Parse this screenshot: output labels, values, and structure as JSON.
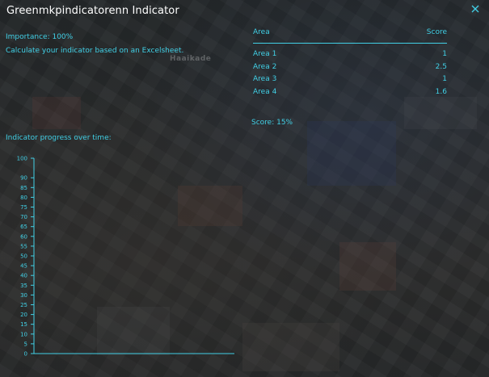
{
  "window": {
    "title": "Greenmkpindicatorenn Indicator"
  },
  "info": {
    "importance": "Importance: 100%",
    "description": "Calculate your indicator based on an Excelsheet."
  },
  "map_label": "Haaikade",
  "table": {
    "headers": {
      "area": "Area",
      "score": "Score"
    },
    "rows": [
      {
        "area": "Area 1",
        "score": "1"
      },
      {
        "area": "Area 2",
        "score": "2.5"
      },
      {
        "area": "Area 3",
        "score": "1"
      },
      {
        "area": "Area 4",
        "score": "1.6"
      }
    ]
  },
  "score_text": "Score: 15%",
  "chart_data": {
    "type": "line",
    "title": "Indicator progress over time:",
    "ylim": [
      0,
      100
    ],
    "yticks": [
      "0",
      "5",
      "10",
      "15",
      "20",
      "25",
      "30",
      "35",
      "40",
      "45",
      "50",
      "55",
      "60",
      "65",
      "70",
      "75",
      "80",
      "85",
      "90",
      "100"
    ],
    "series": []
  },
  "colors": {
    "accent": "#41d0e6",
    "title": "#ffffff"
  },
  "icons": {
    "close": "close-icon"
  }
}
